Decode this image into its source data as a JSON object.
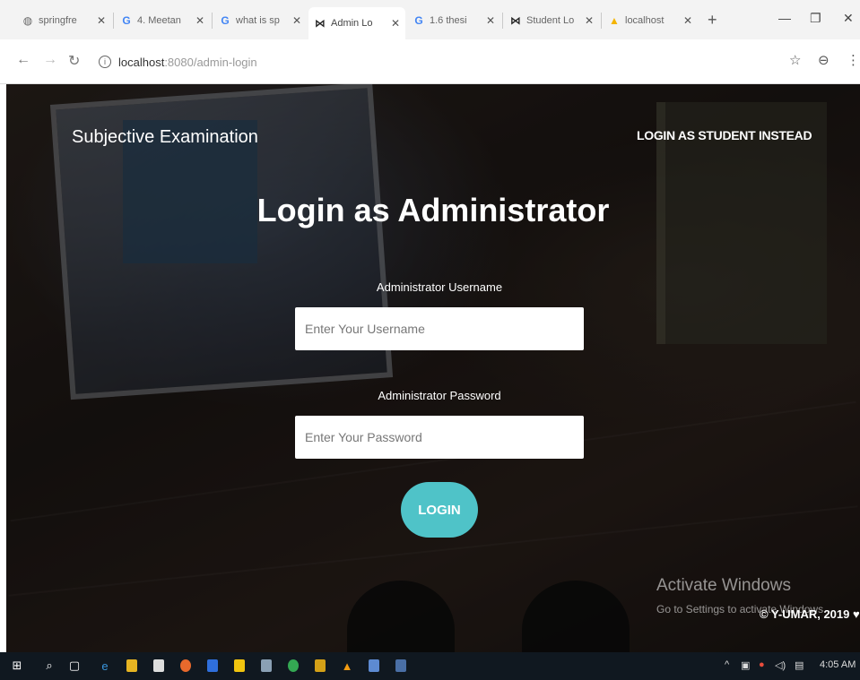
{
  "browser": {
    "tabs": [
      {
        "icon": "globe-icon",
        "glyph": "◍",
        "label": "springfre",
        "active": false
      },
      {
        "icon": "google-icon",
        "glyph": "G",
        "label": "4. Meetan",
        "active": false
      },
      {
        "icon": "google-icon",
        "glyph": "G",
        "label": "what is sp",
        "active": false
      },
      {
        "icon": "bowtie-icon",
        "glyph": "⋈",
        "label": "Admin Lo",
        "active": true
      },
      {
        "icon": "google-icon",
        "glyph": "G",
        "label": "1.6 thesi",
        "active": false
      },
      {
        "icon": "bowtie-icon",
        "glyph": "⋈",
        "label": "Student Lo",
        "active": false
      },
      {
        "icon": "drive-icon",
        "glyph": "▲",
        "label": "localhost",
        "active": false
      }
    ],
    "new_tab": "+",
    "window_controls": {
      "minimize": "—",
      "maximize": "❐",
      "close": "✕"
    },
    "address": {
      "host": "localhost",
      "path": ":8080/admin-login"
    },
    "nav": {
      "back": "←",
      "forward": "→",
      "reload": "↻"
    },
    "icons": {
      "star": "☆",
      "profile": "⊖",
      "menu": "⋮"
    }
  },
  "page": {
    "brand": "Subjective Examination",
    "alt_link": "LOGIN AS STUDENT INSTEAD",
    "heading": "Login as Administrator",
    "username": {
      "label": "Administrator Username",
      "placeholder": "Enter Your Username",
      "value": ""
    },
    "password": {
      "label": "Administrator Password",
      "placeholder": "Enter Your Password",
      "value": ""
    },
    "login_button": "LOGIN",
    "accent_color": "#4fc3c8",
    "watermark": {
      "title": "Activate Windows",
      "subtitle": "Go to Settings to activate Windows."
    },
    "credit": "© Y-UMAR, 2019 ♥"
  },
  "taskbar": {
    "time": "4:05 AM",
    "tray_icons": [
      "chevron-up-icon",
      "network-icon",
      "volume-icon",
      "notification-icon"
    ]
  }
}
